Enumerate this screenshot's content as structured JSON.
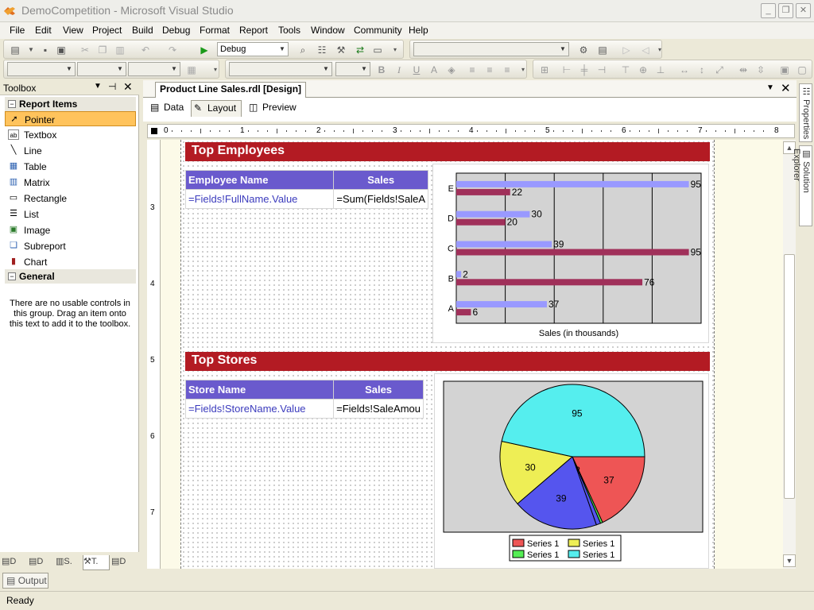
{
  "window": {
    "title": "DemoCompetition - Microsoft Visual Studio",
    "minimize": "_",
    "maximize": "❐",
    "close": "✕"
  },
  "menu": [
    "File",
    "Edit",
    "View",
    "Project",
    "Build",
    "Debug",
    "Format",
    "Report",
    "Tools",
    "Window",
    "Community",
    "Help"
  ],
  "toolbar": {
    "config": "Debug"
  },
  "toolbox": {
    "title": "Toolbox",
    "groups": [
      {
        "label": "Report Items"
      },
      {
        "label": "General"
      }
    ],
    "items": [
      {
        "label": "Pointer",
        "icon": "pointer-icon"
      },
      {
        "label": "Textbox",
        "icon": "textbox-icon"
      },
      {
        "label": "Line",
        "icon": "line-icon"
      },
      {
        "label": "Table",
        "icon": "table-icon"
      },
      {
        "label": "Matrix",
        "icon": "matrix-icon"
      },
      {
        "label": "Rectangle",
        "icon": "rectangle-icon"
      },
      {
        "label": "List",
        "icon": "list-icon"
      },
      {
        "label": "Image",
        "icon": "image-icon"
      },
      {
        "label": "Subreport",
        "icon": "subreport-icon"
      },
      {
        "label": "Chart",
        "icon": "chart-icon"
      }
    ],
    "general_note": "There are no usable controls in this group. Drag an item onto this text to add it to the toolbox."
  },
  "bottom_tabs": [
    "D",
    "D",
    "S.",
    "T.",
    "D"
  ],
  "output_label": "Output",
  "status": "Ready",
  "document": {
    "tab": "Product Line Sales.rdl [Design]",
    "design_tabs": [
      "Data",
      "Layout",
      "Preview"
    ],
    "ruler": [
      "0",
      "1",
      "2",
      "3",
      "4",
      "5",
      "6",
      "7",
      "8"
    ],
    "vruler": [
      "3",
      "4",
      "5",
      "6",
      "7"
    ]
  },
  "report": {
    "employees": {
      "title": "Top Employees",
      "headers": [
        "Employee Name",
        "Sales"
      ],
      "cells": [
        "=Fields!FullName.Value",
        "=Sum(Fields!SaleA"
      ]
    },
    "stores": {
      "title": "Top Stores",
      "headers": [
        "Store Name",
        "Sales"
      ],
      "cells": [
        "=Fields!StoreName.Value",
        "=Fields!SaleAmou"
      ]
    }
  },
  "right_dock": [
    "Properties",
    "Solution Explorer"
  ],
  "chart_data": [
    {
      "type": "bar",
      "orientation": "horizontal",
      "categories": [
        "A",
        "B",
        "C",
        "D",
        "E"
      ],
      "series": [
        {
          "values": [
            6,
            76,
            95,
            20,
            22
          ],
          "color": "#a0305a"
        },
        {
          "values": [
            37,
            2,
            39,
            30,
            95
          ],
          "color": "#9999ff"
        }
      ],
      "xlabel": "Sales (in thousands)",
      "xlim": [
        0,
        100
      ],
      "grid": true
    },
    {
      "type": "pie",
      "values": [
        37,
        1,
        2,
        39,
        30,
        95
      ],
      "colors": [
        "#ee5555",
        "#55ee55",
        "#5555ee",
        "#5555ee",
        "#eeee55",
        "#55eeee"
      ],
      "labels": [
        "37",
        "",
        "2",
        "39",
        "30",
        "95"
      ],
      "legend": [
        {
          "name": "Series 1",
          "color": "#ee5555"
        },
        {
          "name": "Series 1",
          "color": "#eeee55"
        },
        {
          "name": "Series 1",
          "color": "#55ee55"
        },
        {
          "name": "Series 1",
          "color": "#55eeee"
        }
      ],
      "legend_position": "bottom"
    }
  ]
}
